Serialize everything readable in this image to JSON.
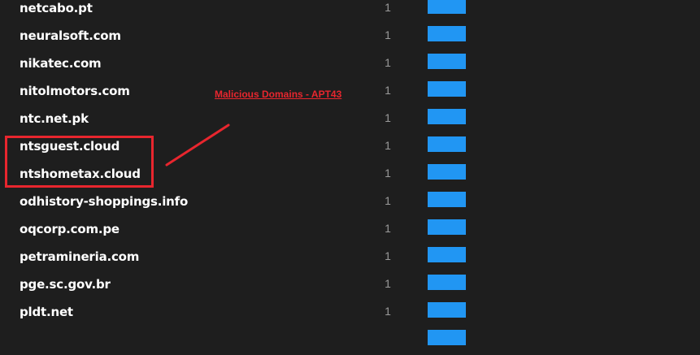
{
  "theme": {
    "bar_color": "#2196f3",
    "annotation_color": "#e8262e"
  },
  "rows": [
    {
      "domain": "netcabo.pt",
      "count": "1",
      "bar_fraction": 1
    },
    {
      "domain": "neuralsoft.com",
      "count": "1",
      "bar_fraction": 1
    },
    {
      "domain": "nikatec.com",
      "count": "1",
      "bar_fraction": 1
    },
    {
      "domain": "nitolmotors.com",
      "count": "1",
      "bar_fraction": 1
    },
    {
      "domain": "ntc.net.pk",
      "count": "1",
      "bar_fraction": 1
    },
    {
      "domain": "ntsguest.cloud",
      "count": "1",
      "bar_fraction": 1
    },
    {
      "domain": "ntshometax.cloud",
      "count": "1",
      "bar_fraction": 1
    },
    {
      "domain": "odhistory-shoppings.info",
      "count": "1",
      "bar_fraction": 1
    },
    {
      "domain": "oqcorp.com.pe",
      "count": "1",
      "bar_fraction": 1
    },
    {
      "domain": "petramineria.com",
      "count": "1",
      "bar_fraction": 1
    },
    {
      "domain": "pge.sc.gov.br",
      "count": "1",
      "bar_fraction": 1
    },
    {
      "domain": "pldt.net",
      "count": "1",
      "bar_fraction": 1
    },
    {
      "domain": "",
      "count": "",
      "bar_fraction": 1
    }
  ],
  "annotation": {
    "label": "Malicious Domains - APT43"
  }
}
